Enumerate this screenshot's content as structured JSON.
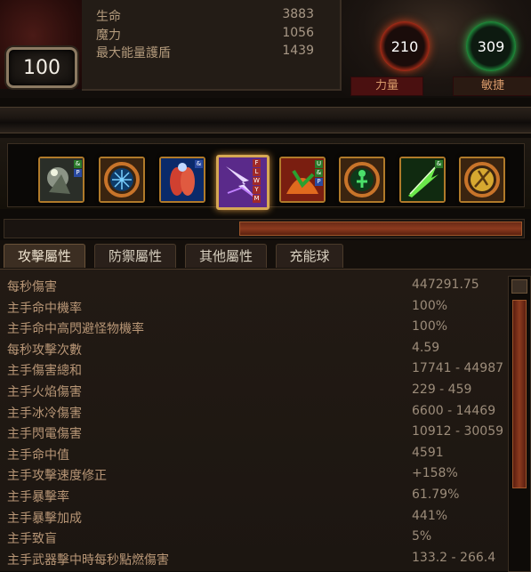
{
  "character": {
    "level": "100",
    "stats": [
      {
        "label": "生命",
        "value": "3883"
      },
      {
        "label": "魔力",
        "value": "1056"
      },
      {
        "label": "最大能量護盾",
        "value": "1439"
      }
    ]
  },
  "attributes": {
    "strength": {
      "value": "210",
      "label": "力量",
      "color": "#e04a1e"
    },
    "dexterity": {
      "value": "309",
      "label": "敏捷",
      "color": "#3ccb58"
    }
  },
  "skills": [
    {
      "icon": "stone-golem-skill-icon",
      "tags": [
        "&",
        "P"
      ],
      "active": false
    },
    {
      "icon": "cold-circle-aura-icon",
      "tags": [],
      "active": false
    },
    {
      "icon": "body-buff-skill-icon",
      "tags": [
        "&"
      ],
      "active": false
    },
    {
      "icon": "lightning-strike-skill-icon",
      "tags": [
        "F",
        "L",
        "W",
        "Y",
        "M"
      ],
      "active": true
    },
    {
      "icon": "fire-warrior-skill-icon",
      "tags": [
        "U",
        "&",
        "P"
      ],
      "active": false
    },
    {
      "icon": "green-figure-aura-icon",
      "tags": [],
      "active": false
    },
    {
      "icon": "green-blade-skill-icon",
      "tags": [
        "&"
      ],
      "active": false
    },
    {
      "icon": "golden-warrior-skill-icon",
      "tags": [],
      "active": false
    }
  ],
  "tabs": [
    {
      "label": "攻擊屬性",
      "active": true
    },
    {
      "label": "防禦屬性",
      "active": false
    },
    {
      "label": "其他屬性",
      "active": false
    },
    {
      "label": "充能球",
      "active": false
    }
  ],
  "properties": [
    {
      "label": "每秒傷害",
      "value": "447291.75"
    },
    {
      "label": "主手命中機率",
      "value": "100%"
    },
    {
      "label": "主手命中高閃避怪物機率",
      "value": "100%"
    },
    {
      "label": "每秒攻擊次數",
      "value": "4.59"
    },
    {
      "label": "主手傷害總和",
      "value": "17741 - 44987"
    },
    {
      "label": "主手火焰傷害",
      "value": "229 - 459"
    },
    {
      "label": "主手冰冷傷害",
      "value": "6600 - 14469"
    },
    {
      "label": "主手閃電傷害",
      "value": "10912 - 30059"
    },
    {
      "label": "主手命中值",
      "value": "4591"
    },
    {
      "label": "主手攻擊速度修正",
      "value": "+158%"
    },
    {
      "label": "主手暴擊率",
      "value": "61.79%"
    },
    {
      "label": "主手暴擊加成",
      "value": "441%"
    },
    {
      "label": "主手致盲",
      "value": "5%"
    },
    {
      "label": "主手武器擊中時每秒點燃傷害",
      "value": "133.2 - 266.4"
    }
  ],
  "scroll": {
    "horizontal_position": 0.46,
    "vertical_position": 0.0
  }
}
